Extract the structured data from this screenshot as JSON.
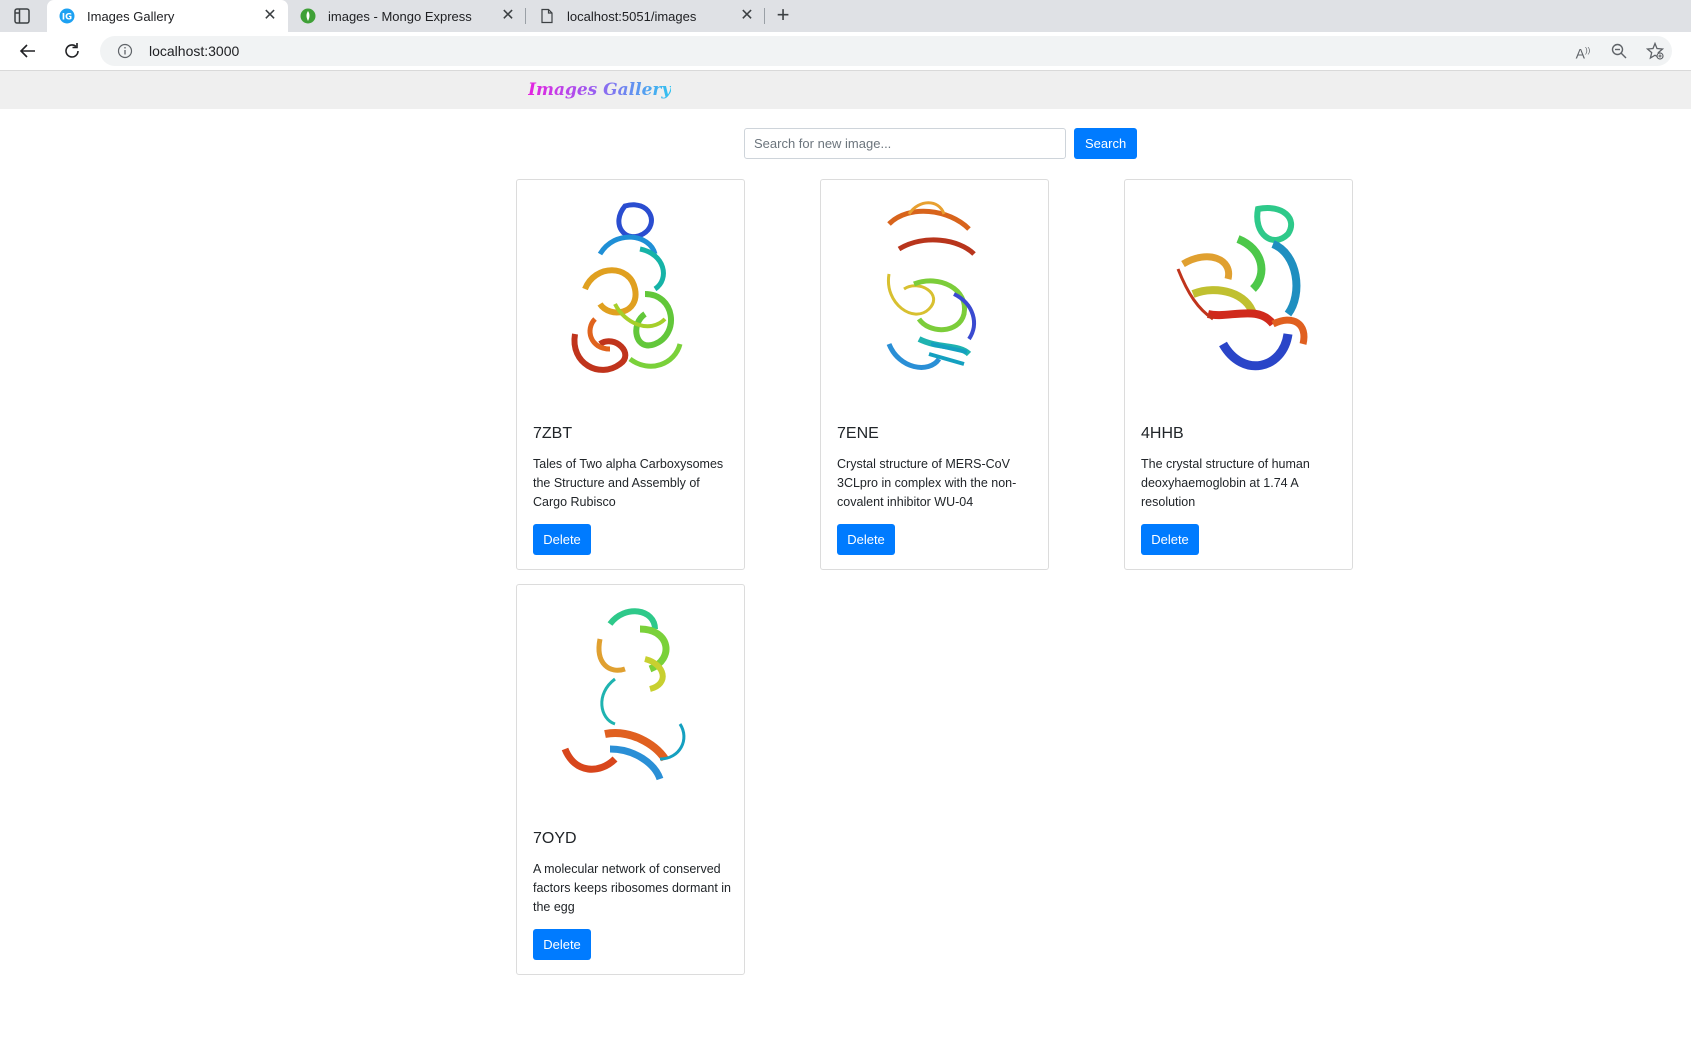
{
  "browser": {
    "tabs": [
      {
        "title": "Images Gallery",
        "favicon": "ig-favicon",
        "active": true
      },
      {
        "title": "images - Mongo Express",
        "favicon": "mongo-leaf-icon",
        "active": false
      },
      {
        "title": "localhost:5051/images",
        "favicon": "page-icon",
        "active": false
      }
    ],
    "url": "localhost:3000"
  },
  "app": {
    "brand": "Images Gallery",
    "search": {
      "placeholder": "Search for new image...",
      "button": "Search"
    },
    "cards": [
      {
        "title": "7ZBT",
        "description": "Tales of Two alpha Carboxysomes the Structure and Assembly of Cargo Rubisco",
        "button": "Delete"
      },
      {
        "title": "7ENE",
        "description": "Crystal structure of MERS-CoV 3CLpro in complex with the non-covalent inhibitor WU-04",
        "button": "Delete"
      },
      {
        "title": "4HHB",
        "description": "The crystal structure of human deoxyhaemoglobin at 1.74 A resolution",
        "button": "Delete"
      },
      {
        "title": "7OYD",
        "description": "A molecular network of conserved factors keeps ribosomes dormant in the egg",
        "button": "Delete"
      }
    ]
  },
  "colors": {
    "primary": "#007bff",
    "header_bg": "#efefef",
    "brand_start": "#e623e0",
    "brand_end": "#2fc2f0"
  }
}
